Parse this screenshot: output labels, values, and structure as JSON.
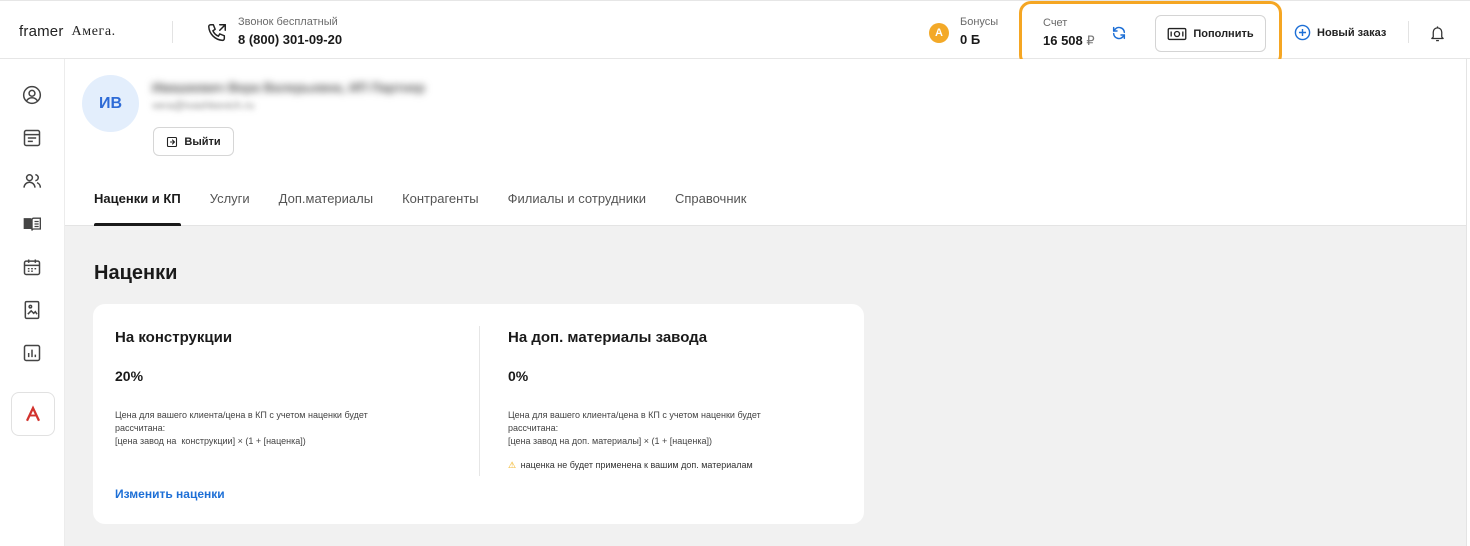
{
  "brand": {
    "framer": "framer",
    "amega": "Амега."
  },
  "phone": {
    "caption": "Звонок бесплатный",
    "number": "8 (800) 301-09-20"
  },
  "bonus": {
    "coin_letter": "A",
    "caption": "Бонусы",
    "value": "0 Б"
  },
  "account": {
    "caption": "Счет",
    "amount": "16 508",
    "currency": "₽",
    "topup_label": "Пополнить"
  },
  "new_order_label": "Новый заказ",
  "profile": {
    "initials": "ИВ",
    "name": "Ивашкевич Вера Валерьевна, ИП Партнер",
    "email": "vera@ivashkevich.ru",
    "logout_label": "Выйти"
  },
  "tabs": [
    {
      "label": "Наценки и КП"
    },
    {
      "label": "Услуги"
    },
    {
      "label": "Доп.материалы"
    },
    {
      "label": "Контрагенты"
    },
    {
      "label": "Филиалы и сотрудники"
    },
    {
      "label": "Справочник"
    }
  ],
  "section_title": "Наценки",
  "markups": {
    "constructions": {
      "title": "На конструкции",
      "value": "20%",
      "desc1": "Цена для вашего клиента/цена в КП с учетом наценки будет",
      "desc2": "рассчитана:",
      "formula": "[цена завод на  конструкции] × (1 + [наценка])"
    },
    "materials": {
      "title": "На доп. материалы завода",
      "value": "0%",
      "desc1": "Цена для вашего клиента/цена в КП с учетом наценки будет",
      "desc2": "рассчитана:",
      "formula": "[цена завод на доп. материалы] × (1 + [наценка])",
      "warning": "наценка не будет применена к вашим доп. материалам"
    },
    "edit_label": "Изменить наценки"
  },
  "colors": {
    "accent_blue": "#1d6fd6",
    "highlight_orange": "#f5a623",
    "coin": "#f3a928",
    "brand_red": "#d2332e"
  }
}
